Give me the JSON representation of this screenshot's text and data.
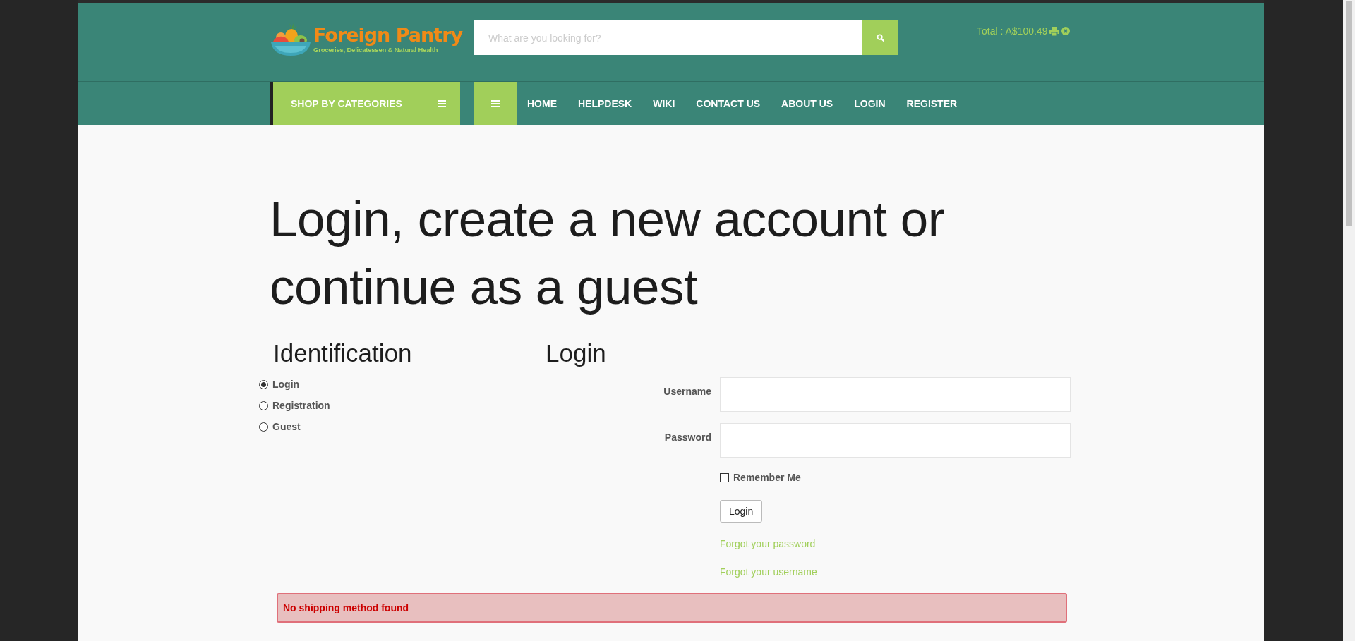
{
  "header": {
    "logo": {
      "name": "Foreign Pantry",
      "tagline": "Groceries, Delicatessen & Natural Health"
    },
    "search": {
      "placeholder": "What are you looking for?"
    },
    "cart": {
      "total": "Total : A$100.49"
    }
  },
  "nav": {
    "categories": "SHOP BY CATEGORIES",
    "links": [
      "HOME",
      "HELPDESK",
      "WIKI",
      "CONTACT US",
      "ABOUT US",
      "LOGIN",
      "REGISTER"
    ]
  },
  "page": {
    "title": "Login, create a new account or continue as a guest"
  },
  "identification": {
    "heading": "Identification",
    "options": [
      {
        "label": "Login",
        "selected": true
      },
      {
        "label": "Registration",
        "selected": false
      },
      {
        "label": "Guest",
        "selected": false
      }
    ]
  },
  "login": {
    "heading": "Login",
    "fields": [
      {
        "label": "Username"
      },
      {
        "label": "Password"
      }
    ],
    "remember": {
      "label": "Remember Me",
      "checked": false
    },
    "button": "Login",
    "links": [
      "Forgot your password",
      "Forgot your username"
    ]
  },
  "alert": {
    "message": "No shipping method found"
  }
}
